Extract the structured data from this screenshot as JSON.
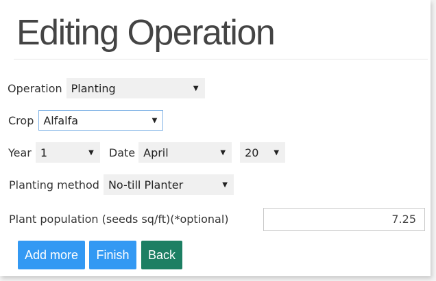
{
  "page": {
    "title": "Editing Operation"
  },
  "form": {
    "operation": {
      "label": "Operation",
      "value": "Planting"
    },
    "crop": {
      "label": "Crop",
      "value": "Alfalfa"
    },
    "year": {
      "label": "Year",
      "value": "1"
    },
    "date": {
      "label": "Date",
      "month": "April",
      "day": "20"
    },
    "planting_method": {
      "label": "Planting method",
      "value": "No-till Planter"
    },
    "plant_population": {
      "label": "Plant population (seeds sq/ft)(*optional)",
      "value": "7.25"
    }
  },
  "buttons": {
    "add_more": "Add more",
    "finish": "Finish",
    "back": "Back"
  },
  "icons": {
    "dropdown": "chevron-down-icon",
    "dropdown_glyph": "▼"
  },
  "colors": {
    "primary_button": "#3399f3",
    "back_button": "#1d7f63",
    "focus_border": "#7fb2e5"
  }
}
